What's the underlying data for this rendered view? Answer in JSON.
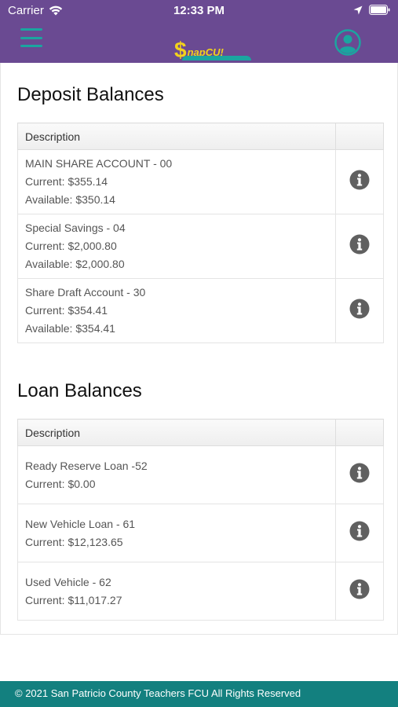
{
  "status_bar": {
    "carrier": "Carrier",
    "time": "12:33 PM"
  },
  "header": {
    "logo_dollar": "$",
    "logo_text": "napCU!",
    "brand_color": "#6a4a92",
    "accent_color": "#1ba5a0",
    "logo_color": "#f2d21c",
    "menu_icon": "hamburger-menu-icon",
    "account_icon": "user-account-icon"
  },
  "deposit": {
    "title": "Deposit Balances",
    "header": "Description",
    "rows": [
      {
        "name": "MAIN SHARE ACCOUNT - 00",
        "current": "Current: $355.14",
        "available": "Available: $350.14"
      },
      {
        "name": "Special Savings - 04",
        "current": "Current: $2,000.80",
        "available": "Available: $2,000.80"
      },
      {
        "name": "Share Draft Account - 30",
        "current": "Current: $354.41",
        "available": "Available: $354.41"
      }
    ]
  },
  "loan": {
    "title": "Loan Balances",
    "header": "Description",
    "rows": [
      {
        "name": "Ready Reserve Loan -52",
        "current": "Current: $0.00"
      },
      {
        "name": "New Vehicle Loan - 61",
        "current": "Current: $12,123.65"
      },
      {
        "name": "Used Vehicle - 62",
        "current": "Current: $11,017.27"
      }
    ]
  },
  "footer": {
    "text": "© 2021 San Patricio County Teachers FCU All Rights Reserved",
    "color": "#13807f"
  }
}
